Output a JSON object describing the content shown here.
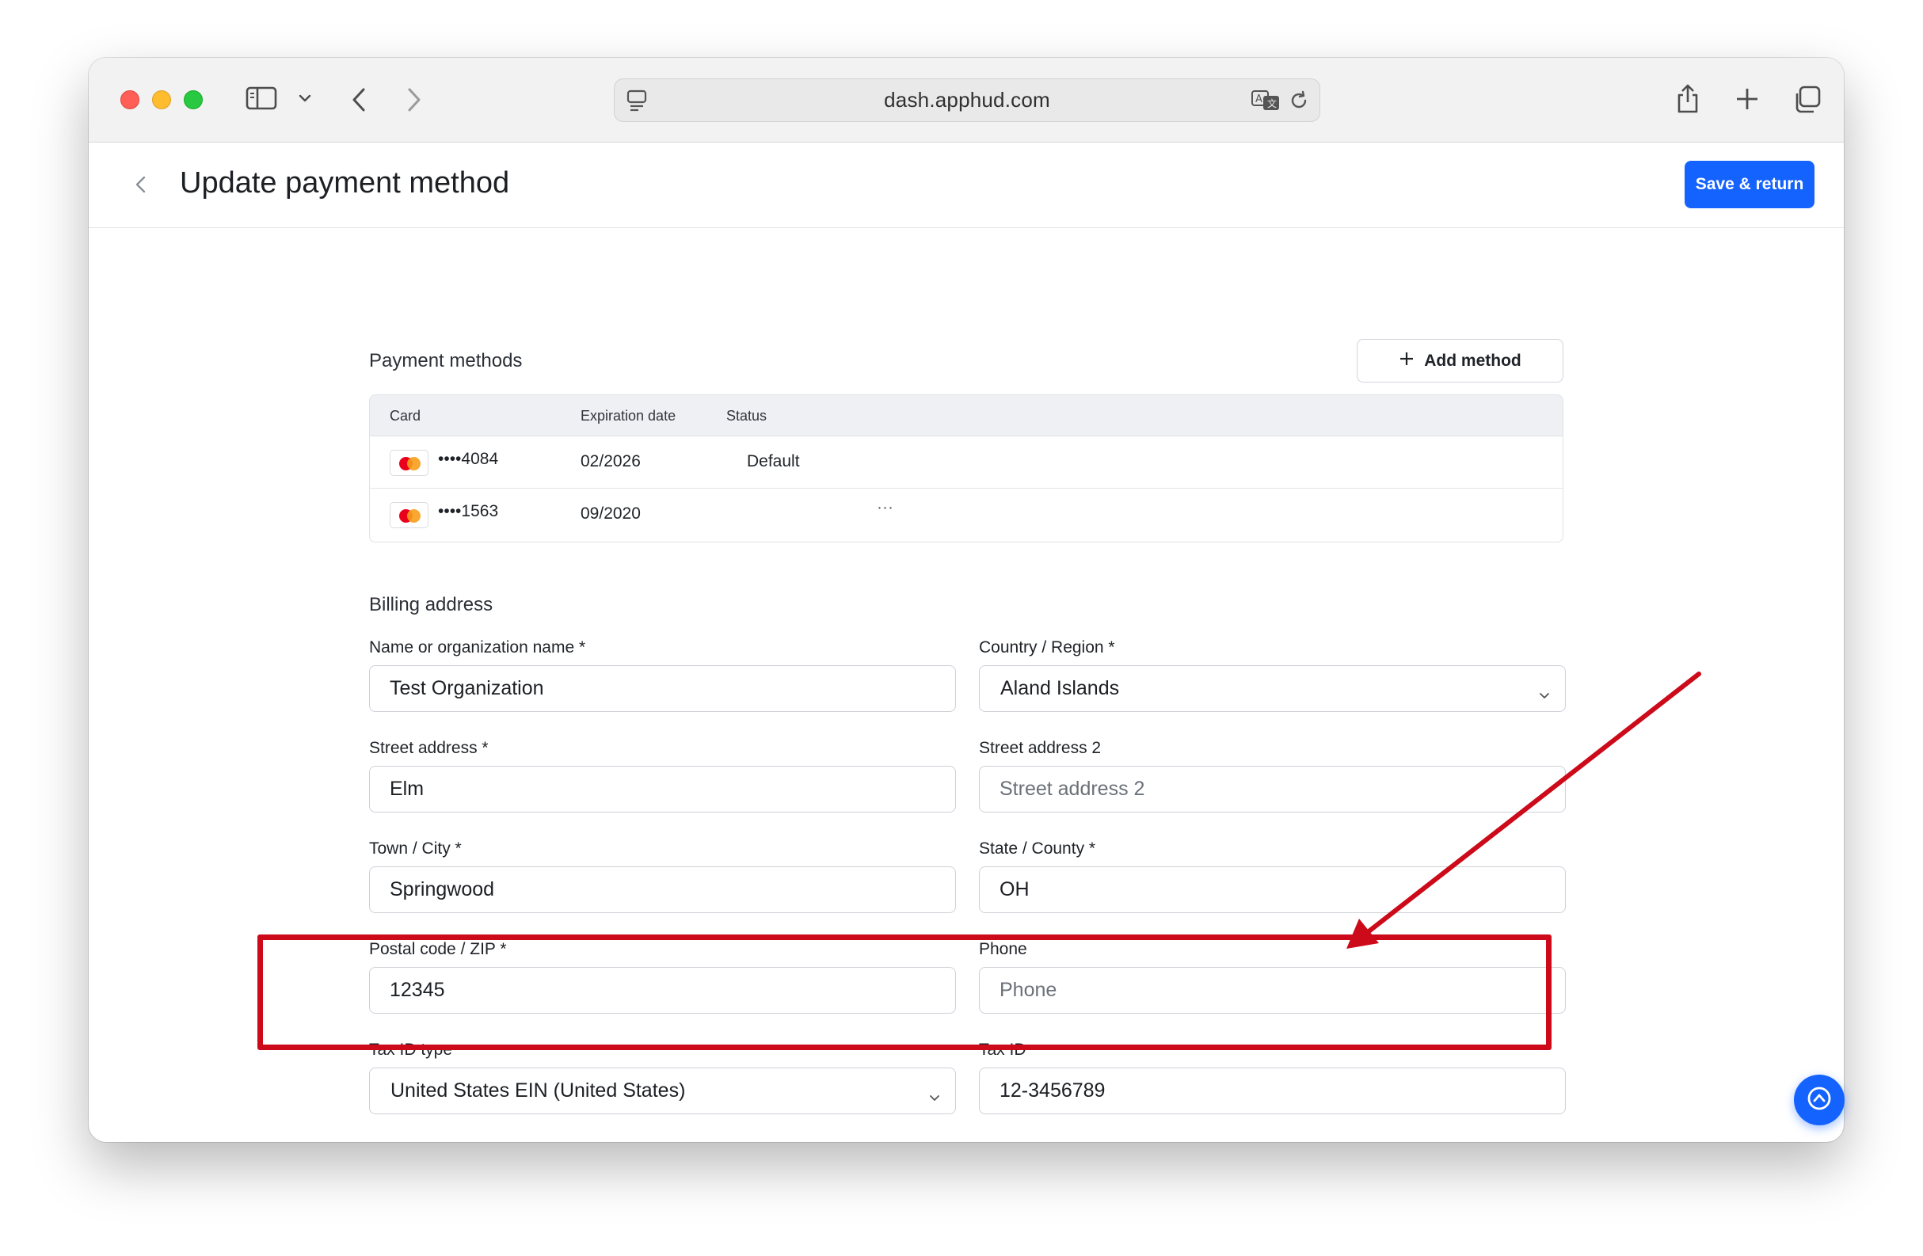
{
  "browser": {
    "url": "dash.apphud.com"
  },
  "header": {
    "title": "Update payment method",
    "save_button": "Save & return"
  },
  "payment_methods": {
    "title": "Payment methods",
    "add_button": "Add method",
    "columns": [
      "Card",
      "Expiration date",
      "Status"
    ],
    "rows": [
      {
        "card": "••••4084",
        "expiration": "02/2026",
        "status": "Default",
        "actions": ""
      },
      {
        "card": "••••1563",
        "expiration": "09/2020",
        "status": "",
        "actions": "···"
      }
    ]
  },
  "billing": {
    "title": "Billing address",
    "name": {
      "label": "Name or organization name *",
      "value": "Test Organization",
      "placeholder": ""
    },
    "country": {
      "label": "Country / Region *",
      "value": "Aland Islands"
    },
    "street": {
      "label": "Street address *",
      "value": "Elm",
      "placeholder": ""
    },
    "street2": {
      "label": "Street address 2",
      "value": "",
      "placeholder": "Street address 2"
    },
    "city": {
      "label": "Town / City *",
      "value": "Springwood",
      "placeholder": ""
    },
    "state": {
      "label": "State / County *",
      "value": "OH",
      "placeholder": ""
    },
    "postal": {
      "label": "Postal code / ZIP *",
      "value": "12345",
      "placeholder": ""
    },
    "phone": {
      "label": "Phone",
      "value": "",
      "placeholder": "Phone"
    },
    "tax_type": {
      "label": "Tax ID type",
      "value": "United States EIN (United States)"
    },
    "tax_id": {
      "label": "Tax ID",
      "value": "12-3456789",
      "placeholder": ""
    }
  },
  "colors": {
    "primary": "#1463ff",
    "annotation": "#cc0a1a"
  },
  "icons": {
    "sidebar": "sidebar-icon",
    "back": "chevron-left-icon",
    "forward": "chevron-right-icon",
    "share": "share-icon",
    "new_tab": "plus-icon",
    "tabs": "tabs-overview-icon",
    "translate": "translate-icon",
    "reload": "reload-icon",
    "support": "chat-support-icon"
  }
}
